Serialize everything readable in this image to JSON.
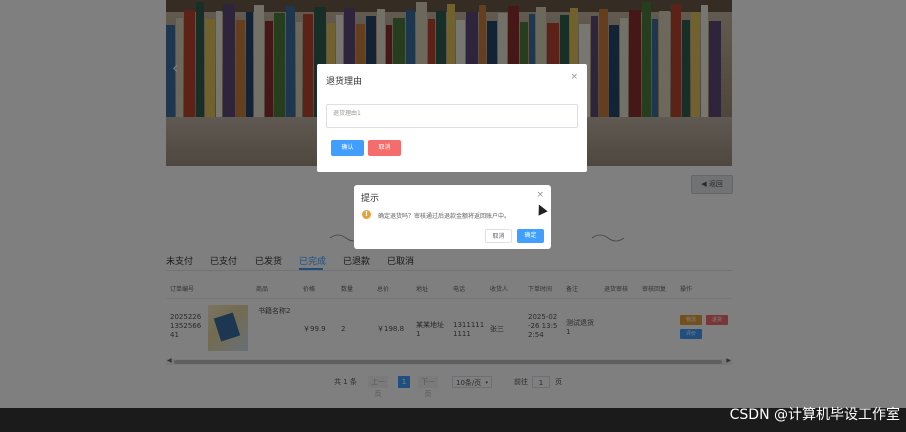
{
  "banner": {
    "prev_arrow": "‹"
  },
  "back_button": {
    "icon": "◀",
    "label": "返回"
  },
  "tabs": [
    {
      "label": "未支付",
      "active": false
    },
    {
      "label": "已支付",
      "active": false
    },
    {
      "label": "已发货",
      "active": false
    },
    {
      "label": "已完成",
      "active": true
    },
    {
      "label": "已退款",
      "active": false
    },
    {
      "label": "已取消",
      "active": false
    }
  ],
  "table": {
    "headers": [
      "订单编号",
      "商品",
      "价格",
      "数量",
      "总价",
      "地址",
      "电话",
      "收货人",
      "下单时间",
      "备注",
      "退货审核",
      "审核回复",
      "操作"
    ],
    "row": {
      "order_no": "2025226135256641",
      "order_no_lines": [
        "2025226",
        "1352566",
        "41"
      ],
      "product_name": "书籍名称2",
      "price": "￥99.9",
      "quantity": "2",
      "total": "￥198.8",
      "address_lines": [
        "某某地址",
        "1"
      ],
      "phone_lines": [
        "1311111",
        "1111"
      ],
      "receiver": "张三",
      "time_lines": [
        "2025-02",
        "-26 13:5",
        "2:54"
      ],
      "remark_lines": [
        "测试退货",
        "1"
      ],
      "ops": [
        "物流",
        "退货",
        "评价"
      ]
    }
  },
  "pagination": {
    "total": "共 1 条",
    "prev": "上一页",
    "current": "1",
    "next": "下一页",
    "page_size": "10条/页",
    "goto_label": "前往",
    "goto_value": "1",
    "page_suffix": "页"
  },
  "return_dialog": {
    "title": "退货理由",
    "close": "×",
    "placeholder": "退货理由1",
    "confirm": "确认",
    "cancel": "取消"
  },
  "confirm_dialog": {
    "title": "提示",
    "close": "×",
    "icon": "!",
    "message": "确定退货吗？审核通过后退款金额将返回账户中。",
    "cancel": "取消",
    "ok": "确定"
  },
  "watermark": "CSDN @计算机毕设工作室",
  "colors": {
    "primary": "#409eff",
    "warning": "#e6a23c",
    "danger": "#e06b60",
    "success": "#67c23a"
  }
}
